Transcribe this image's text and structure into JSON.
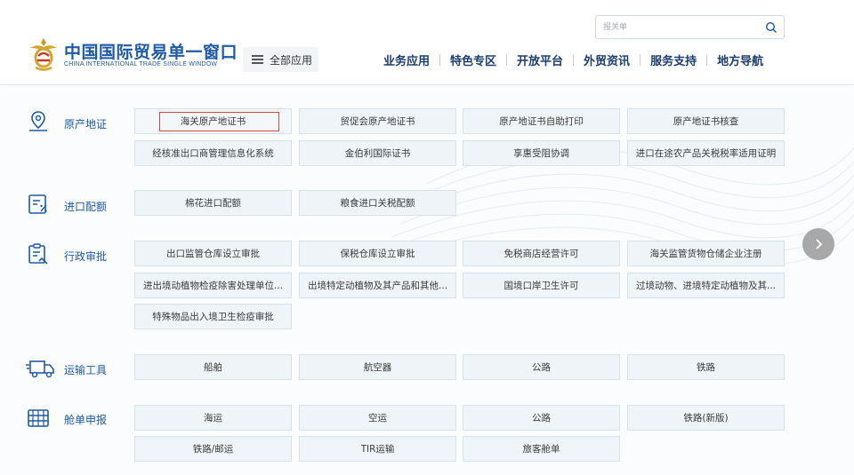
{
  "brand": {
    "name_cn": "中国国际贸易单一窗口",
    "name_en": "CHINA INTERNATIONAL TRADE SINGLE WINDOW"
  },
  "header": {
    "all_apps_label": "全部应用",
    "search_placeholder": "报关单",
    "nav": [
      "业务应用",
      "特色专区",
      "开放平台",
      "外贸资讯",
      "服务支持",
      "地方导航"
    ]
  },
  "colors": {
    "brand_blue": "#1f5aa6",
    "nav_text": "#1c3d6e",
    "button_bg": "#eef4f8",
    "selected_border": "#d9453d",
    "arrow_bg": "#9a9a9a"
  },
  "categories": [
    {
      "icon": "location-pin-icon",
      "label": "原产地证",
      "buttons": [
        "海关原产地证书",
        "贸促会原产地证书",
        "原产地证书自助打印",
        "原产地证书核查",
        "经核准出口商管理信息化系统",
        "金伯利国际证书",
        "享惠受阻协调",
        "进口在途农产品关税税率适用证明"
      ]
    },
    {
      "icon": "quota-document-icon",
      "label": "进口配额",
      "buttons": [
        "棉花进口配额",
        "粮食进口关税配额"
      ]
    },
    {
      "icon": "approval-clipboard-icon",
      "label": "行政审批",
      "buttons": [
        "出口监管仓库设立审批",
        "保税仓库设立审批",
        "免税商店经营许可",
        "海关监管货物仓储企业注册",
        "进出境动植物检疫除害处理单位...",
        "出境特定动植物及其产品和其他...",
        "国境口岸卫生许可",
        "过境动物、进境特定动植物及其...",
        "特殊物品出入境卫生检疫审批"
      ]
    },
    {
      "icon": "truck-icon",
      "label": "运输工具",
      "buttons": [
        "船舶",
        "航空器",
        "公路",
        "铁路"
      ]
    },
    {
      "icon": "manifest-icon",
      "label": "舱单申报",
      "buttons": [
        "海运",
        "空运",
        "公路",
        "铁路(新版)",
        "铁路/邮运",
        "TIR运输",
        "旅客舱单"
      ]
    }
  ]
}
